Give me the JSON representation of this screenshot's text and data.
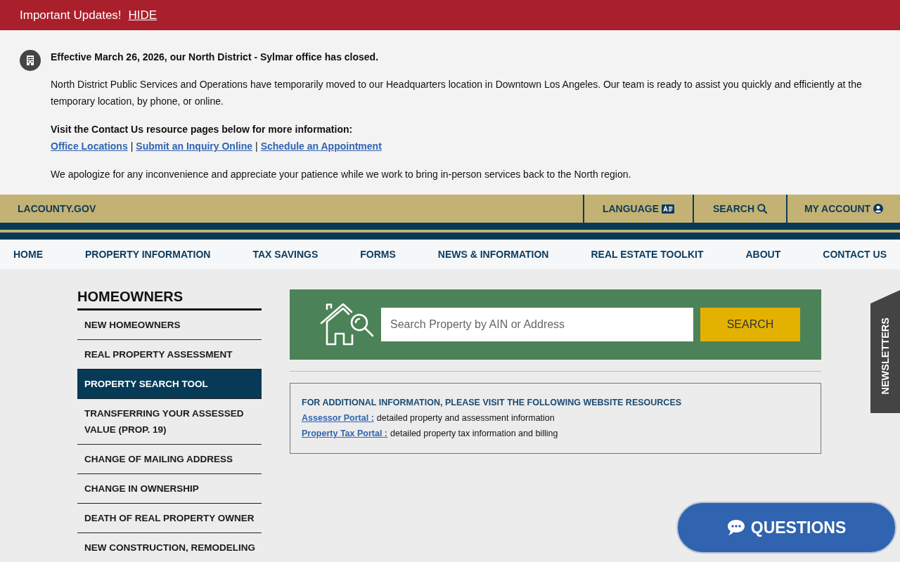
{
  "alert_bar": {
    "title": "Important Updates!",
    "hide_link": "HIDE"
  },
  "notice": {
    "heading": "Effective March 26, 2026, our North District - Sylmar office has closed.",
    "paragraph": "North District Public Services and Operations have temporarily moved to our Headquarters location in Downtown Los Angeles. Our team is ready to assist you quickly and efficiently at the temporary location, by phone, or online.",
    "links_intro": "Visit the Contact Us resource pages below for more information:",
    "links": [
      {
        "kind": "link",
        "text": "Office Locations"
      },
      {
        "kind": "separator",
        "text": "|"
      },
      {
        "kind": "link",
        "text": "Submit an Inquiry Online"
      },
      {
        "kind": "separator",
        "text": "|"
      },
      {
        "kind": "link",
        "text": "Schedule an Appointment"
      }
    ],
    "closing": "We apologize for any inconvenience and appreciate your patience while we work to bring in-person services back to the North region."
  },
  "utility_bar": {
    "site_link": "LACOUNTY.GOV",
    "items": [
      {
        "kind": "language",
        "label": "LANGUAGE"
      },
      {
        "kind": "search",
        "label": "SEARCH"
      },
      {
        "kind": "account",
        "label": "MY ACCOUNT"
      }
    ]
  },
  "main_nav": {
    "items": [
      {
        "label": "HOME"
      },
      {
        "label": "PROPERTY INFORMATION"
      },
      {
        "label": "TAX SAVINGS"
      },
      {
        "label": "FORMS"
      },
      {
        "label": "NEWS & INFORMATION"
      },
      {
        "label": "REAL ESTATE TOOLKIT"
      },
      {
        "label": "ABOUT"
      },
      {
        "label": "CONTACT US"
      }
    ]
  },
  "sidebar": {
    "title": "HOMEOWNERS",
    "items": [
      {
        "label": "NEW HOMEOWNERS",
        "selected": false
      },
      {
        "label": "REAL PROPERTY ASSESSMENT",
        "selected": false
      },
      {
        "label": "PROPERTY SEARCH TOOL",
        "selected": true
      },
      {
        "label": "TRANSFERRING YOUR ASSESSED VALUE (PROP. 19)",
        "selected": false
      },
      {
        "label": "CHANGE OF MAILING ADDRESS",
        "selected": false
      },
      {
        "label": "CHANGE IN OWNERSHIP",
        "selected": false
      },
      {
        "label": "DEATH OF REAL PROPERTY OWNER",
        "selected": false
      },
      {
        "label": "NEW CONSTRUCTION, REMODELING",
        "selected": false
      }
    ]
  },
  "search_panel": {
    "placeholder": "Search Property by AIN or Address",
    "button": "SEARCH"
  },
  "resources": {
    "heading": "FOR ADDITIONAL INFORMATION, PLEASE VISIT THE FOLLOWING WEBSITE RESOURCES",
    "items": [
      {
        "link": "Assessor Portal :",
        "description": "detailed property and assessment information"
      },
      {
        "link": "Property Tax Portal :",
        "description": "detailed property tax information and billing"
      }
    ]
  },
  "newsletter_tab": {
    "label": "NEWSLETTERS"
  },
  "questions_button": {
    "label": "QUESTIONS"
  }
}
